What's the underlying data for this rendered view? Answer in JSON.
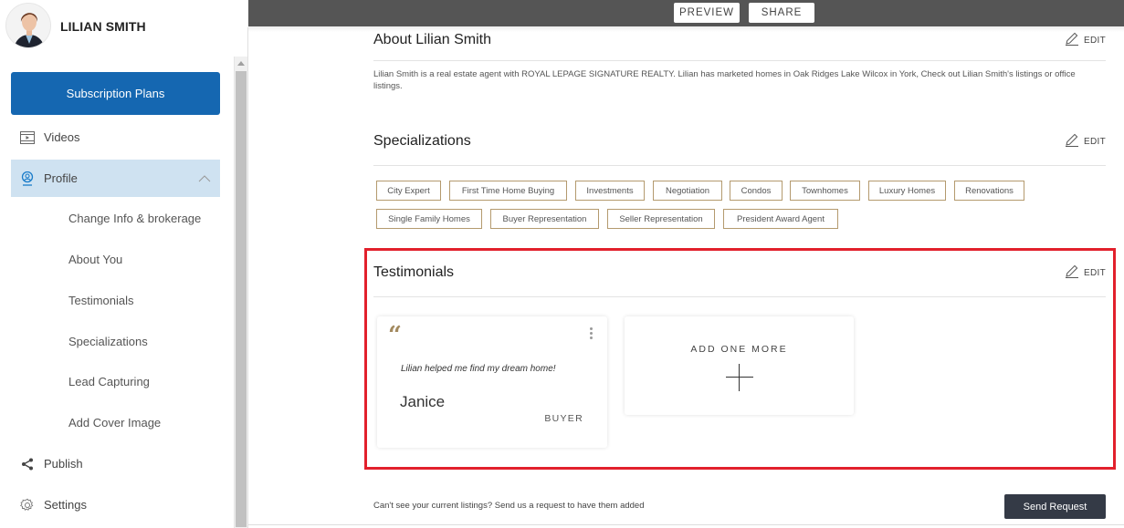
{
  "user": {
    "name": "LILIAN SMITH",
    "avatar": "agent-portrait"
  },
  "sidebar": {
    "subscription_button": "Subscription Plans",
    "items": [
      {
        "label": "Videos",
        "icon": "video-icon"
      },
      {
        "label": "Profile",
        "icon": "profile-icon",
        "expanded": true
      },
      {
        "label": "Publish",
        "icon": "share-icon"
      },
      {
        "label": "Settings",
        "icon": "gear-icon"
      }
    ],
    "profile_subitems": [
      "Change Info & brokerage",
      "About You",
      "Testimonials",
      "Specializations",
      "Lead Capturing",
      "Add Cover Image"
    ]
  },
  "topbar": {
    "preview": "PREVIEW",
    "share": "SHARE"
  },
  "about": {
    "title": "About Lilian Smith",
    "edit": "EDIT",
    "text": "Lilian Smith is a real estate agent with ROYAL LEPAGE SIGNATURE REALTY. Lilian has marketed homes in Oak Ridges Lake Wilcox in York, Check out Lilian Smith's listings or office listings."
  },
  "specializations": {
    "title": "Specializations",
    "edit": "EDIT",
    "tags": [
      "City Expert",
      "First Time Home Buying",
      "Investments",
      "Negotiation",
      "Condos",
      "Townhomes",
      "Luxury Homes",
      "Renovations",
      "Single Family Homes",
      "Buyer Representation",
      "Seller Representation",
      "President Award Agent"
    ]
  },
  "testimonials": {
    "title": "Testimonials",
    "edit": "EDIT",
    "items": [
      {
        "quote": "Lilian helped me find my dream home!",
        "name": "Janice",
        "role": "BUYER"
      }
    ],
    "add_label": "ADD ONE MORE"
  },
  "footer": {
    "text": "Can't see your current listings? Send us a request to have them added",
    "button": "Send Request"
  },
  "colors": {
    "accent": "#1567b1",
    "tag_border": "#b49a6e",
    "highlight": "#e2202c",
    "topbar": "#555555"
  }
}
